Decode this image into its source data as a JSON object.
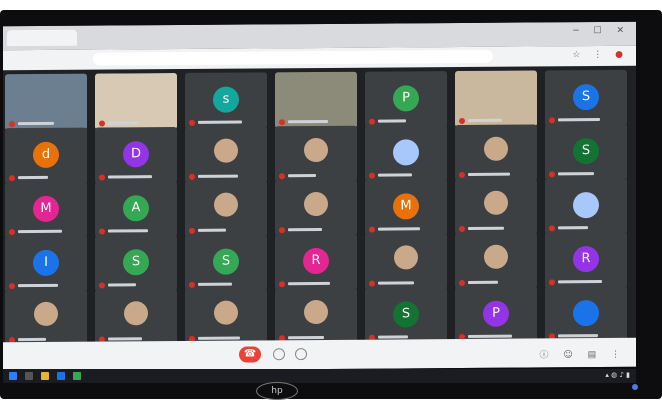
{
  "meeting": {
    "hangup_icon": "phone-hangup-icon",
    "participants": [
      {
        "kind": "video",
        "row": 0,
        "col": 0,
        "bg": "#6b7f90"
      },
      {
        "kind": "video",
        "row": 0,
        "col": 1,
        "bg": "#d8c9b4"
      },
      {
        "kind": "avatar",
        "row": 0,
        "col": 2,
        "letter": "s",
        "color": "#12a89d"
      },
      {
        "kind": "video",
        "row": 0,
        "col": 3,
        "bg": "#8c8a78"
      },
      {
        "kind": "avatar",
        "row": 0,
        "col": 4,
        "letter": "P",
        "color": "#34a853"
      },
      {
        "kind": "video",
        "row": 0,
        "col": 5,
        "bg": "#c9b89e"
      },
      {
        "kind": "avatar",
        "row": 0,
        "col": 6,
        "letter": "S",
        "color": "#1a73e8"
      },
      {
        "kind": "avatar",
        "row": 1,
        "col": 0,
        "letter": "d",
        "color": "#e8710a"
      },
      {
        "kind": "avatar",
        "row": 1,
        "col": 1,
        "letter": "D",
        "color": "#9334e6"
      },
      {
        "kind": "photo",
        "row": 1,
        "col": 2
      },
      {
        "kind": "photo",
        "row": 1,
        "col": 3
      },
      {
        "kind": "avatar",
        "row": 1,
        "col": 4,
        "letter": "",
        "color": "#a8c7fa"
      },
      {
        "kind": "photo",
        "row": 1,
        "col": 5
      },
      {
        "kind": "avatar",
        "row": 1,
        "col": 6,
        "letter": "S",
        "color": "#137333"
      },
      {
        "kind": "avatar",
        "row": 2,
        "col": 0,
        "letter": "M",
        "color": "#e52592"
      },
      {
        "kind": "avatar",
        "row": 2,
        "col": 1,
        "letter": "A",
        "color": "#34a853"
      },
      {
        "kind": "photo",
        "row": 2,
        "col": 2
      },
      {
        "kind": "photo",
        "row": 2,
        "col": 3
      },
      {
        "kind": "avatar",
        "row": 2,
        "col": 4,
        "letter": "M",
        "color": "#e8710a"
      },
      {
        "kind": "photo",
        "row": 2,
        "col": 5
      },
      {
        "kind": "avatar",
        "row": 2,
        "col": 6,
        "letter": "",
        "color": "#a8c7fa"
      },
      {
        "kind": "avatar",
        "row": 3,
        "col": 0,
        "letter": "I",
        "color": "#1a73e8"
      },
      {
        "kind": "avatar",
        "row": 3,
        "col": 1,
        "letter": "S",
        "color": "#34a853"
      },
      {
        "kind": "avatar",
        "row": 3,
        "col": 2,
        "letter": "S",
        "color": "#34a853"
      },
      {
        "kind": "avatar",
        "row": 3,
        "col": 3,
        "letter": "R",
        "color": "#e52592"
      },
      {
        "kind": "photo",
        "row": 3,
        "col": 4
      },
      {
        "kind": "photo",
        "row": 3,
        "col": 5
      },
      {
        "kind": "avatar",
        "row": 3,
        "col": 6,
        "letter": "R",
        "color": "#9334e6"
      },
      {
        "kind": "photo",
        "row": 4,
        "col": 0
      },
      {
        "kind": "photo",
        "row": 4,
        "col": 1
      },
      {
        "kind": "photo",
        "row": 4,
        "col": 2
      },
      {
        "kind": "photo",
        "row": 4,
        "col": 3
      },
      {
        "kind": "avatar",
        "row": 4,
        "col": 4,
        "letter": "S",
        "color": "#137333"
      },
      {
        "kind": "avatar",
        "row": 4,
        "col": 5,
        "letter": "P",
        "color": "#9334e6"
      },
      {
        "kind": "avatar",
        "row": 4,
        "col": 6,
        "letter": "",
        "color": "#1a73e8"
      }
    ]
  },
  "device": {
    "brand_logo": "hp-logo"
  }
}
